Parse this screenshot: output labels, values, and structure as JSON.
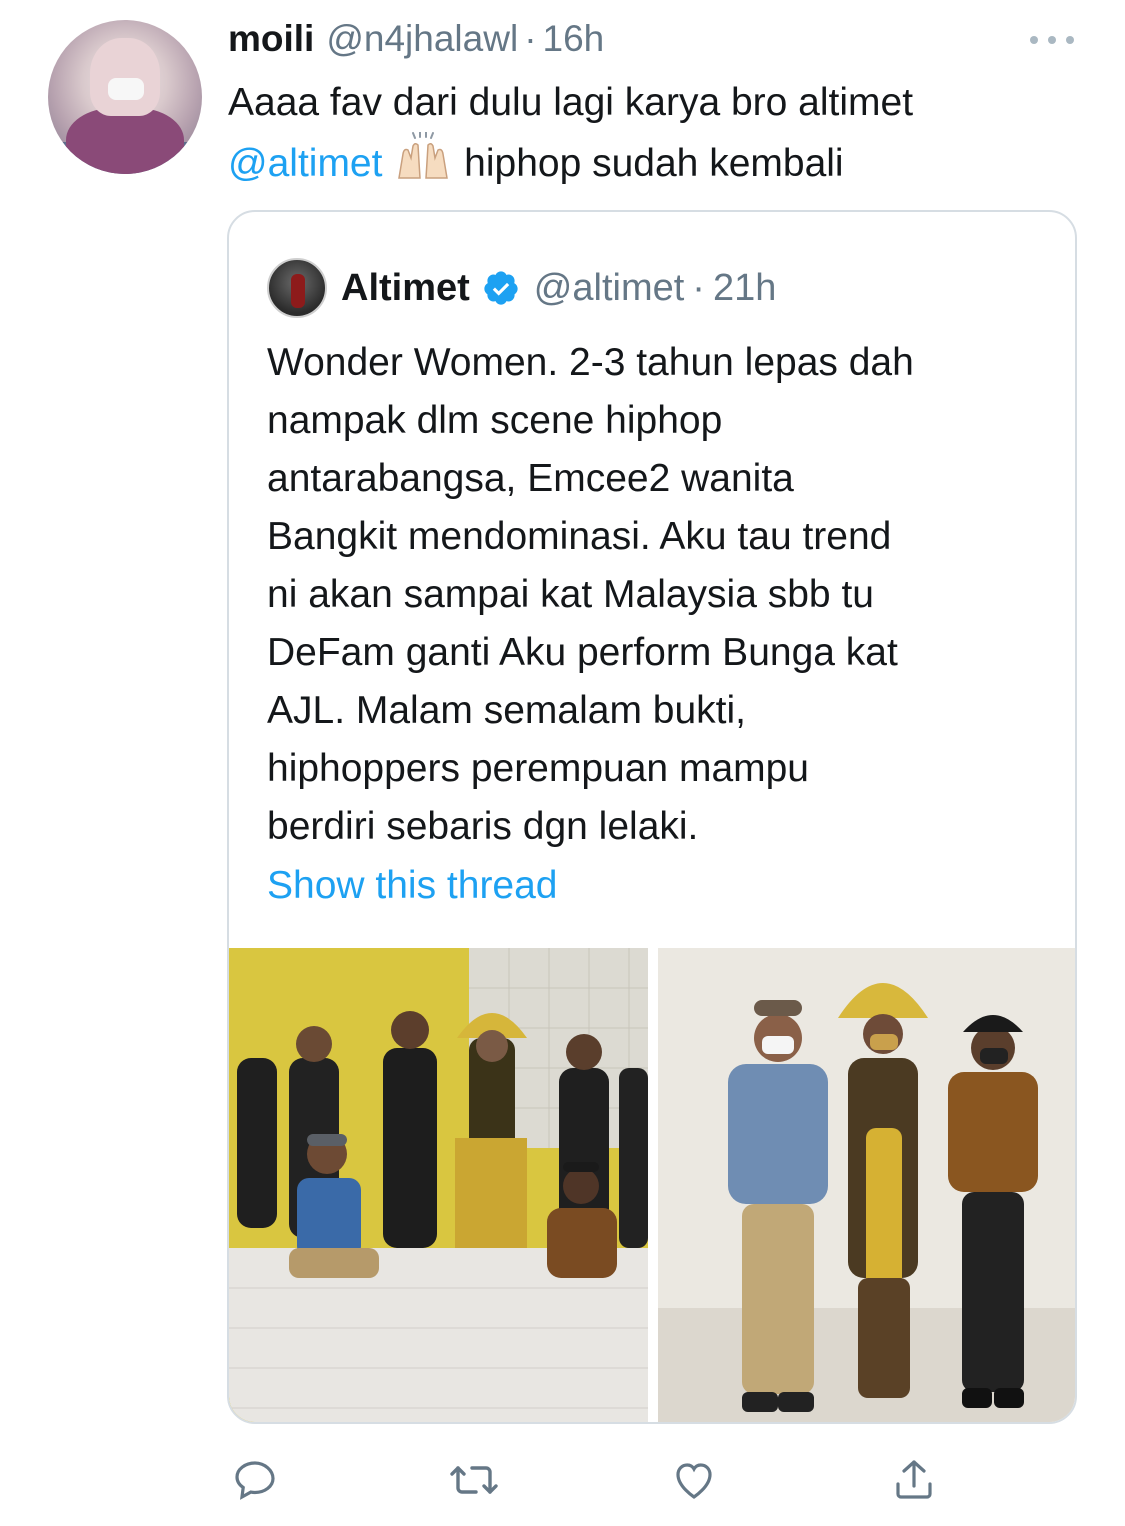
{
  "tweet": {
    "display_name": "moili",
    "handle": "@n4jhalawl",
    "separator": "·",
    "time": "16h",
    "text_line1": "Aaaa fav dari dulu lagi karya bro altimet",
    "mention": "@altimet",
    "emoji": "🙌🏻",
    "text_line2_rest": " hiphop sudah kembali"
  },
  "quote": {
    "display_name": "Altimet",
    "verified": true,
    "handle": "@altimet",
    "separator": "·",
    "time": "21h",
    "text_lines": [
      "Wonder Women. 2-3 tahun lepas dah",
      "nampak dlm scene hiphop",
      "antarabangsa, Emcee2 wanita",
      "Bangkit mendominasi. Aku tau trend",
      "ni akan sampai kat Malaysia sbb tu",
      "DeFam ganti Aku perform Bunga kat",
      "AJL. Malam semalam bukti,",
      "hiphoppers perempuan mampu",
      "berdiri sebaris dgn lelaki."
    ],
    "show_thread": "Show this thread"
  },
  "icons": {
    "reply": "reply-icon",
    "retweet": "retweet-icon",
    "like": "like-icon",
    "share": "share-icon",
    "more": "more-icon",
    "verified": "verified-badge-icon"
  },
  "colors": {
    "link": "#1da1f2",
    "muted": "#657786",
    "text": "#14171a",
    "border": "#d6dde3",
    "icon": "#657786"
  }
}
